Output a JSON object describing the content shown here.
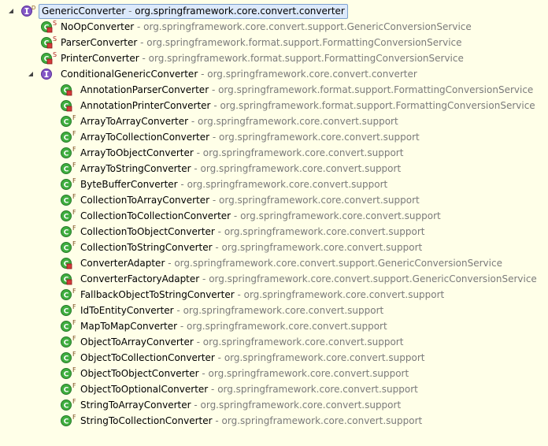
{
  "tree": {
    "root": {
      "name": "GenericConverter",
      "package": "org.springframework.core.convert.converter",
      "icon": "interface-icon",
      "expanded": true
    },
    "children": [
      {
        "name": "NoOpConverter",
        "package": "org.springframework.core.convert.support.GenericConversionService",
        "icon": "static-private-class-icon",
        "modifier": "S"
      },
      {
        "name": "ParserConverter",
        "package": "org.springframework.format.support.FormattingConversionService",
        "icon": "static-private-class-icon",
        "modifier": "S"
      },
      {
        "name": "PrinterConverter",
        "package": "org.springframework.format.support.FormattingConversionService",
        "icon": "static-private-class-icon",
        "modifier": "S"
      },
      {
        "name": "ConditionalGenericConverter",
        "package": "org.springframework.core.convert.converter",
        "icon": "interface-icon",
        "expanded": true
      }
    ],
    "grandchildren": [
      {
        "name": "AnnotationParserConverter",
        "package": "org.springframework.format.support.FormattingConversionService",
        "icon": "private-class-icon",
        "modifier": ""
      },
      {
        "name": "AnnotationPrinterConverter",
        "package": "org.springframework.format.support.FormattingConversionService",
        "icon": "private-class-icon",
        "modifier": ""
      },
      {
        "name": "ArrayToArrayConverter",
        "package": "org.springframework.core.convert.support",
        "icon": "final-class-icon",
        "modifier": "F"
      },
      {
        "name": "ArrayToCollectionConverter",
        "package": "org.springframework.core.convert.support",
        "icon": "final-class-icon",
        "modifier": "F"
      },
      {
        "name": "ArrayToObjectConverter",
        "package": "org.springframework.core.convert.support",
        "icon": "final-class-icon",
        "modifier": "F"
      },
      {
        "name": "ArrayToStringConverter",
        "package": "org.springframework.core.convert.support",
        "icon": "final-class-icon",
        "modifier": "F"
      },
      {
        "name": "ByteBufferConverter",
        "package": "org.springframework.core.convert.support",
        "icon": "final-class-icon",
        "modifier": "F"
      },
      {
        "name": "CollectionToArrayConverter",
        "package": "org.springframework.core.convert.support",
        "icon": "final-class-icon",
        "modifier": "F"
      },
      {
        "name": "CollectionToCollectionConverter",
        "package": "org.springframework.core.convert.support",
        "icon": "final-class-icon",
        "modifier": "F"
      },
      {
        "name": "CollectionToObjectConverter",
        "package": "org.springframework.core.convert.support",
        "icon": "final-class-icon",
        "modifier": "F"
      },
      {
        "name": "CollectionToStringConverter",
        "package": "org.springframework.core.convert.support",
        "icon": "final-class-icon",
        "modifier": "F"
      },
      {
        "name": "ConverterAdapter",
        "package": "org.springframework.core.convert.support.GenericConversionService",
        "icon": "private-class-icon",
        "modifier": ""
      },
      {
        "name": "ConverterFactoryAdapter",
        "package": "org.springframework.core.convert.support.GenericConversionService",
        "icon": "private-class-icon",
        "modifier": ""
      },
      {
        "name": "FallbackObjectToStringConverter",
        "package": "org.springframework.core.convert.support",
        "icon": "final-class-icon",
        "modifier": "F"
      },
      {
        "name": "IdToEntityConverter",
        "package": "org.springframework.core.convert.support",
        "icon": "final-class-icon",
        "modifier": "F"
      },
      {
        "name": "MapToMapConverter",
        "package": "org.springframework.core.convert.support",
        "icon": "final-class-icon",
        "modifier": "F"
      },
      {
        "name": "ObjectToArrayConverter",
        "package": "org.springframework.core.convert.support",
        "icon": "final-class-icon",
        "modifier": "F"
      },
      {
        "name": "ObjectToCollectionConverter",
        "package": "org.springframework.core.convert.support",
        "icon": "final-class-icon",
        "modifier": "F"
      },
      {
        "name": "ObjectToObjectConverter",
        "package": "org.springframework.core.convert.support",
        "icon": "final-class-icon",
        "modifier": "F"
      },
      {
        "name": "ObjectToOptionalConverter",
        "package": "org.springframework.core.convert.support",
        "icon": "final-class-icon",
        "modifier": "F"
      },
      {
        "name": "StringToArrayConverter",
        "package": "org.springframework.core.convert.support",
        "icon": "final-class-icon",
        "modifier": "F"
      },
      {
        "name": "StringToCollectionConverter",
        "package": "org.springframework.core.convert.support",
        "icon": "final-class-icon",
        "modifier": "F"
      }
    ],
    "separator": " - ",
    "colors": {
      "background": "#ffffe8",
      "package_text": "#7a7a7a",
      "class_green": "#3a9a3a",
      "private_red": "#d33b3b",
      "interface_purple": "#6f3fb0",
      "modifier_red": "#b22222",
      "modifier_brown": "#7a4a1a",
      "selection_fill": "#dce9fb",
      "selection_border": "#7da2ce"
    }
  }
}
